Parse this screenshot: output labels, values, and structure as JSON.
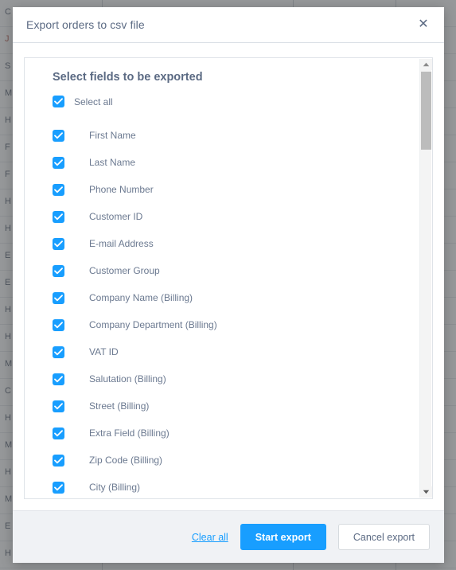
{
  "modal": {
    "title": "Export orders to csv file",
    "close_icon": "close-icon",
    "panel_heading": "Select fields to be exported",
    "select_all_label": "Select all",
    "fields": [
      {
        "label": "First Name",
        "checked": true
      },
      {
        "label": "Last Name",
        "checked": true
      },
      {
        "label": "Phone Number",
        "checked": true
      },
      {
        "label": "Customer ID",
        "checked": true
      },
      {
        "label": "E-mail Address",
        "checked": true
      },
      {
        "label": "Customer Group",
        "checked": true
      },
      {
        "label": "Company Name (Billing)",
        "checked": true
      },
      {
        "label": "Company Department (Billing)",
        "checked": true
      },
      {
        "label": "VAT ID",
        "checked": true
      },
      {
        "label": "Salutation (Billing)",
        "checked": true
      },
      {
        "label": "Street (Billing)",
        "checked": true
      },
      {
        "label": "Extra Field (Billing)",
        "checked": true
      },
      {
        "label": "Zip Code (Billing)",
        "checked": true
      },
      {
        "label": "City (Billing)",
        "checked": true
      }
    ],
    "scrollbar": {
      "up_icon": "triangle-up-icon",
      "down_icon": "triangle-down-icon"
    },
    "footer": {
      "clear_all": "Clear all",
      "start_export": "Start export",
      "cancel_export": "Cancel export"
    }
  },
  "background": {
    "rows": [
      "C",
      "J",
      "S",
      "M",
      "H",
      "F",
      "F",
      "H",
      "H",
      "E",
      "E",
      "H",
      "H",
      "M",
      "C",
      "H",
      "M",
      "H",
      "M",
      "E",
      "H"
    ],
    "colors": {
      "accent": "#189eff",
      "text": "#6b7990",
      "footer_bg": "#f0f2f5"
    }
  }
}
